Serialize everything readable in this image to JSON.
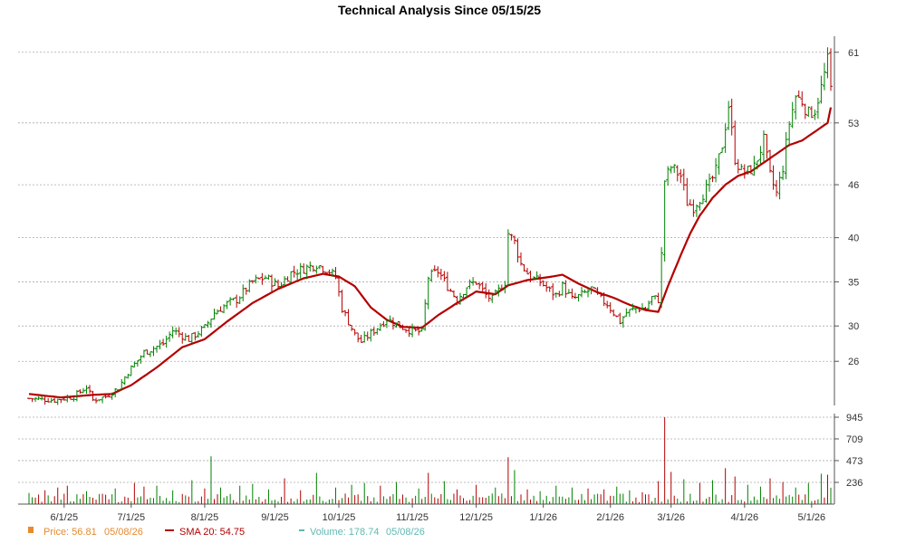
{
  "chart_data": {
    "type": "ohlc",
    "title": "Technical Analysis Since 05/15/25",
    "price_axis": {
      "ticks": [
        26,
        30,
        35,
        40,
        46,
        53,
        61
      ],
      "range": [
        21,
        62
      ]
    },
    "volume_axis": {
      "ticks": [
        236,
        473,
        709,
        945
      ],
      "range": [
        0,
        945
      ]
    },
    "x_axis": {
      "ticks": [
        {
          "label": "6/1/25",
          "index": 11
        },
        {
          "label": "7/1/25",
          "index": 32
        },
        {
          "label": "8/1/25",
          "index": 55
        },
        {
          "label": "9/1/25",
          "index": 77
        },
        {
          "label": "10/1/25",
          "index": 97
        },
        {
          "label": "11/1/25",
          "index": 120
        },
        {
          "label": "12/1/25",
          "index": 140
        },
        {
          "label": "1/1/26",
          "index": 161
        },
        {
          "label": "2/1/26",
          "index": 182
        },
        {
          "label": "3/1/26",
          "index": 201
        },
        {
          "label": "4/1/26",
          "index": 224
        },
        {
          "label": "5/1/26",
          "index": 245
        }
      ],
      "total_bars": 252
    },
    "price_anchors": [
      [
        0,
        21.8
      ],
      [
        8,
        21.6
      ],
      [
        14,
        22.0
      ],
      [
        18,
        23.1
      ],
      [
        20,
        21.6
      ],
      [
        24,
        22.0
      ],
      [
        28,
        23.0
      ],
      [
        31,
        24.8
      ],
      [
        36,
        27.0
      ],
      [
        42,
        28.0
      ],
      [
        45,
        29.5
      ],
      [
        50,
        28.5
      ],
      [
        55,
        29.8
      ],
      [
        58,
        31.5
      ],
      [
        62,
        32.5
      ],
      [
        65,
        33.0
      ],
      [
        70,
        35.0
      ],
      [
        74,
        35.5
      ],
      [
        78,
        34.5
      ],
      [
        82,
        36.0
      ],
      [
        86,
        36.5
      ],
      [
        90,
        37.0
      ],
      [
        94,
        36.2
      ],
      [
        96,
        35.5
      ],
      [
        98,
        32.0
      ],
      [
        100,
        30.5
      ],
      [
        102,
        29.0
      ],
      [
        104,
        28.2
      ],
      [
        108,
        29.5
      ],
      [
        112,
        30.8
      ],
      [
        116,
        30.0
      ],
      [
        120,
        29.4
      ],
      [
        123,
        29.3
      ],
      [
        125,
        35.5
      ],
      [
        128,
        36.2
      ],
      [
        131,
        34.5
      ],
      [
        134,
        33.0
      ],
      [
        137,
        34.5
      ],
      [
        140,
        35.0
      ],
      [
        143,
        33.5
      ],
      [
        145,
        33.0
      ],
      [
        147,
        34.0
      ],
      [
        149,
        35.0
      ],
      [
        150,
        40.5
      ],
      [
        152,
        39.5
      ],
      [
        154,
        37.0
      ],
      [
        157,
        35.5
      ],
      [
        160,
        35.0
      ],
      [
        163,
        34.0
      ],
      [
        165,
        33.5
      ],
      [
        167,
        34.5
      ],
      [
        170,
        33.0
      ],
      [
        173,
        33.5
      ],
      [
        176,
        34.2
      ],
      [
        179,
        33.0
      ],
      [
        181,
        32.5
      ],
      [
        183,
        31.5
      ],
      [
        185,
        30.5
      ],
      [
        187,
        31.5
      ],
      [
        190,
        32.0
      ],
      [
        193,
        32.0
      ],
      [
        195,
        33.2
      ],
      [
        197,
        33.0
      ],
      [
        198,
        38.0
      ],
      [
        199,
        46.5
      ],
      [
        201,
        48.0
      ],
      [
        204,
        47.0
      ],
      [
        206,
        44.0
      ],
      [
        208,
        43.5
      ],
      [
        210,
        44.5
      ],
      [
        213,
        46.0
      ],
      [
        215,
        47.5
      ],
      [
        217,
        50.5
      ],
      [
        219,
        55.0
      ],
      [
        221,
        49.0
      ],
      [
        223,
        47.5
      ],
      [
        225,
        47.5
      ],
      [
        227,
        48.0
      ],
      [
        230,
        51.0
      ],
      [
        232,
        47.0
      ],
      [
        234,
        45.0
      ],
      [
        236,
        48.0
      ],
      [
        238,
        53.0
      ],
      [
        240,
        56.0
      ],
      [
        242,
        55.5
      ],
      [
        244,
        54.0
      ],
      [
        246,
        54.5
      ],
      [
        248,
        57.0
      ],
      [
        250,
        60.0
      ],
      [
        251,
        56.81
      ]
    ],
    "sma_anchors": [
      [
        0,
        22.3
      ],
      [
        10,
        21.9
      ],
      [
        20,
        22.2
      ],
      [
        26,
        22.3
      ],
      [
        32,
        23.3
      ],
      [
        40,
        25.3
      ],
      [
        48,
        27.6
      ],
      [
        55,
        28.5
      ],
      [
        62,
        30.5
      ],
      [
        70,
        32.6
      ],
      [
        78,
        34.2
      ],
      [
        86,
        35.4
      ],
      [
        92,
        35.9
      ],
      [
        97,
        35.6
      ],
      [
        102,
        34.5
      ],
      [
        107,
        32.1
      ],
      [
        112,
        30.7
      ],
      [
        117,
        29.9
      ],
      [
        123,
        29.8
      ],
      [
        128,
        31.2
      ],
      [
        134,
        32.6
      ],
      [
        140,
        33.9
      ],
      [
        146,
        33.6
      ],
      [
        150,
        34.6
      ],
      [
        156,
        35.2
      ],
      [
        162,
        35.5
      ],
      [
        167,
        35.8
      ],
      [
        172,
        34.8
      ],
      [
        178,
        33.8
      ],
      [
        183,
        33.2
      ],
      [
        188,
        32.4
      ],
      [
        193,
        31.8
      ],
      [
        197,
        31.6
      ],
      [
        200,
        34.5
      ],
      [
        204,
        38.0
      ],
      [
        207,
        40.5
      ],
      [
        210,
        42.5
      ],
      [
        214,
        44.5
      ],
      [
        218,
        46.0
      ],
      [
        222,
        47.0
      ],
      [
        226,
        47.5
      ],
      [
        230,
        48.5
      ],
      [
        234,
        49.5
      ],
      [
        238,
        50.5
      ],
      [
        242,
        51.0
      ],
      [
        246,
        52.0
      ],
      [
        250,
        53.0
      ],
      [
        251,
        54.75
      ]
    ],
    "volume_spikes": [
      [
        0,
        120
      ],
      [
        5,
        150
      ],
      [
        9,
        180
      ],
      [
        12,
        200
      ],
      [
        18,
        140
      ],
      [
        22,
        110
      ],
      [
        27,
        170
      ],
      [
        33,
        230
      ],
      [
        36,
        190
      ],
      [
        40,
        200
      ],
      [
        45,
        150
      ],
      [
        51,
        260
      ],
      [
        55,
        170
      ],
      [
        57,
        520
      ],
      [
        60,
        180
      ],
      [
        66,
        200
      ],
      [
        70,
        220
      ],
      [
        75,
        160
      ],
      [
        80,
        280
      ],
      [
        85,
        150
      ],
      [
        90,
        340
      ],
      [
        96,
        180
      ],
      [
        101,
        210
      ],
      [
        105,
        230
      ],
      [
        110,
        200
      ],
      [
        115,
        240
      ],
      [
        122,
        170
      ],
      [
        125,
        340
      ],
      [
        130,
        250
      ],
      [
        134,
        160
      ],
      [
        140,
        210
      ],
      [
        146,
        180
      ],
      [
        150,
        510
      ],
      [
        152,
        370
      ],
      [
        156,
        160
      ],
      [
        160,
        140
      ],
      [
        165,
        200
      ],
      [
        170,
        180
      ],
      [
        175,
        170
      ],
      [
        180,
        160
      ],
      [
        184,
        190
      ],
      [
        188,
        150
      ],
      [
        192,
        130
      ],
      [
        197,
        250
      ],
      [
        199,
        945
      ],
      [
        201,
        350
      ],
      [
        205,
        270
      ],
      [
        210,
        230
      ],
      [
        214,
        260
      ],
      [
        218,
        390
      ],
      [
        221,
        300
      ],
      [
        225,
        210
      ],
      [
        229,
        190
      ],
      [
        232,
        280
      ],
      [
        236,
        240
      ],
      [
        240,
        180
      ],
      [
        244,
        230
      ],
      [
        248,
        330
      ],
      [
        250,
        320
      ],
      [
        251,
        178.74
      ]
    ],
    "colors": {
      "up": "#008000",
      "down": "#b30000",
      "sma": "#b30000",
      "price_marker": "#e58a2e",
      "grid": "#aaaaaa"
    },
    "legend": {
      "price_label": "Price: 56.81",
      "price_date": "05/08/26",
      "sma_label": "SMA 20: 54.75",
      "volume_label": "Volume: 178.74",
      "volume_date": "05/08/26"
    },
    "grid": true
  }
}
